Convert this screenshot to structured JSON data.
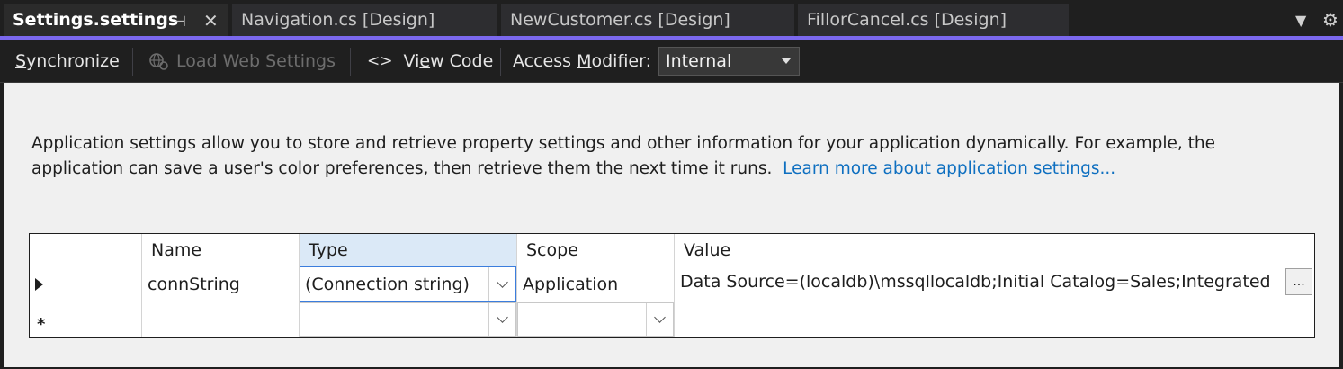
{
  "tabs": [
    {
      "label": "Settings.settings",
      "active": true
    },
    {
      "label": "Navigation.cs [Design]"
    },
    {
      "label": "NewCustomer.cs [Design]"
    },
    {
      "label": "FillorCancel.cs [Design]"
    }
  ],
  "tab_icons": {
    "pin": "pin-icon",
    "close": "close-icon",
    "dropdown": "tab-dropdown-icon",
    "settings": "gear-icon"
  },
  "toolbar": {
    "synchronize_s": "S",
    "synchronize_rest": "ynchronize",
    "load_web_settings": "Load Web Settings",
    "view_code_pre": "Vi",
    "view_code_u": "e",
    "view_code_post": "w Code",
    "view_code_icon": "<>",
    "access_modifier_pre": "Access ",
    "access_modifier_u": "M",
    "access_modifier_post": "odifier:",
    "access_modifier_value": "Internal"
  },
  "description": {
    "text": "Application settings allow you to store and retrieve property settings and other information for your application dynamically. For example, the application can save a user's color preferences, then retrieve them the next time it runs.",
    "link": "Learn more about application settings..."
  },
  "grid": {
    "columns": [
      "Name",
      "Type",
      "Scope",
      "Value"
    ],
    "rows": [
      {
        "name": "connString",
        "type": "(Connection string)",
        "scope": "Application",
        "value": "Data Source=(localdb)\\mssqllocaldb;Initial Catalog=Sales;Integrated",
        "ellipsis": "..."
      }
    ],
    "new_row_marker": "*"
  },
  "colors": {
    "accent": "#7b68ee",
    "link": "#0e6fc0",
    "header_highlight": "#dbe9f7"
  }
}
